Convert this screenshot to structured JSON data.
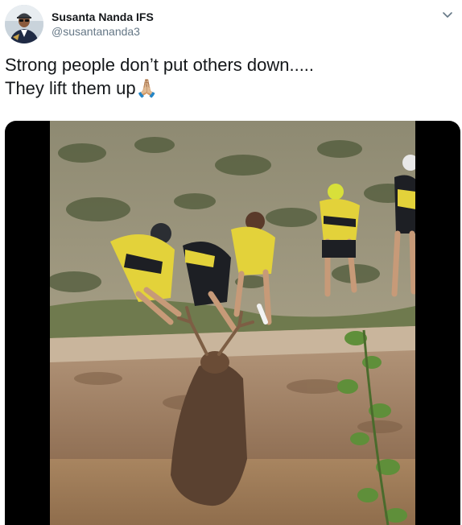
{
  "author": {
    "display_name": "Susanta Nanda IFS",
    "handle": "@susantananda3"
  },
  "tweet": {
    "line1": "Strong people don’t put others down.....",
    "line2": "They lift them up",
    "emoji": "🙏🏼"
  },
  "icons": {
    "menu": "chevron-down-icon",
    "avatar": "avatar-photo",
    "media": "video-thumbnail"
  },
  "colors": {
    "text": "#14171a",
    "secondary": "#657786",
    "video_letterbox": "#000000"
  }
}
